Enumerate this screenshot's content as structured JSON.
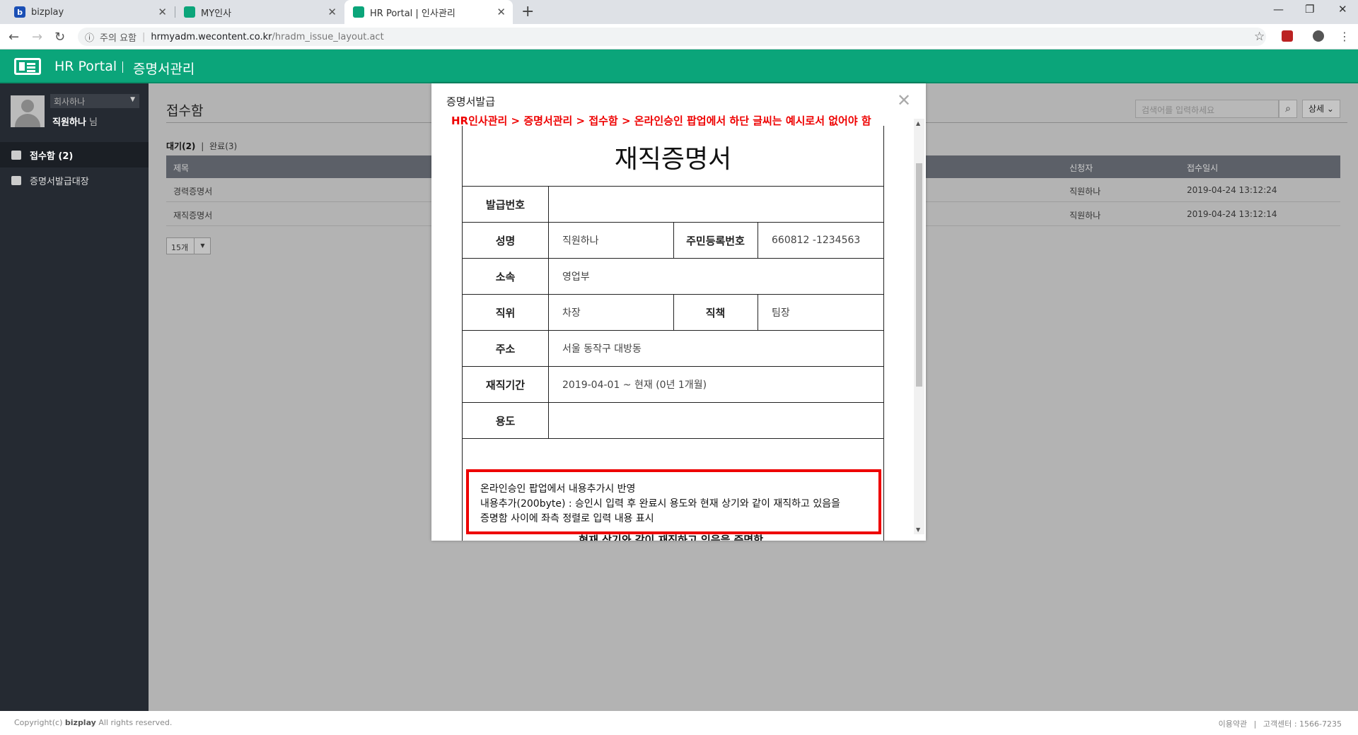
{
  "browser": {
    "tabs": [
      {
        "title": "bizplay",
        "favicon_color": "#1a4fb5",
        "favicon_letter": "b"
      },
      {
        "title": "MY인사",
        "favicon_color": "#0ba57a",
        "favicon_letter": ""
      },
      {
        "title": "HR Portal | 인사관리",
        "favicon_color": "#0ba57a",
        "favicon_letter": ""
      }
    ],
    "security_label": "주의 요함",
    "url_host": "hrmyadm.wecontent.co.kr",
    "url_path": "/hradm_issue_layout.act"
  },
  "app": {
    "title": "HR Portal",
    "subtitle": "증명서관리",
    "brand_color": "#0ba57a"
  },
  "sidebar": {
    "company": "회사하나",
    "user_name": "직원하나",
    "user_suffix": "님",
    "items": [
      {
        "label": "접수함 (2)",
        "icon": "inbox-icon",
        "active": true
      },
      {
        "label": "증명서발급대장",
        "icon": "printer-icon",
        "active": false
      }
    ]
  },
  "main": {
    "page_title": "접수함",
    "search_placeholder": "검색어를 입력하세요",
    "detail_label": "상세",
    "filter_waiting": "대기(2)",
    "filter_sep": "|",
    "filter_done": "완료(3)",
    "columns": {
      "title": "제목",
      "requester": "신청자",
      "date": "접수일시"
    },
    "rows": [
      {
        "title": "경력증명서",
        "requester": "직원하나",
        "date": "2019-04-24 13:12:24"
      },
      {
        "title": "재직증명서",
        "requester": "직원하나",
        "date": "2019-04-24 13:12:14"
      }
    ],
    "page_size": "15개"
  },
  "footer": {
    "copyright_prefix": "Copyright(c)",
    "brand": "bizplay",
    "copyright_suffix": "All rights reserved.",
    "terms": "이용약관",
    "support": "고객센터 : 1566-7235"
  },
  "modal": {
    "title": "증명서발급",
    "annotation": "HR인사관리 > 증명서관리 > 접수함 > 온라인승인 팝업에서 하단 글씨는 예시로서 없어야 함",
    "cert_title": "재직증명서",
    "fields": {
      "issue_no_label": "발급번호",
      "issue_no": "",
      "name_label": "성명",
      "name": "직원하나",
      "rrn_label": "주민등록번호",
      "rrn": "660812 -1234563",
      "dept_label": "소속",
      "dept": "영업부",
      "position_label": "직위",
      "position": "차장",
      "duty_label": "직책",
      "duty": "팀장",
      "address_label": "주소",
      "address": "서울 동작구 대방동",
      "period_label": "재직기간",
      "period": "2019-04-01 ~ 현재 (0년 1개월)",
      "purpose_label": "용도",
      "purpose": ""
    },
    "note_lines": [
      "온라인승인 팝업에서 내용추가시 반영",
      "내용추가(200byte) : 승인시 입력 후 완료시 용도와 현재 상기와 같이 재직하고 있음을",
      "증명함 사이에 좌측 정렬로 입력 내용 표시"
    ],
    "footer_text": "현재 상기와 같이 재직하고 있음을 증명함."
  }
}
